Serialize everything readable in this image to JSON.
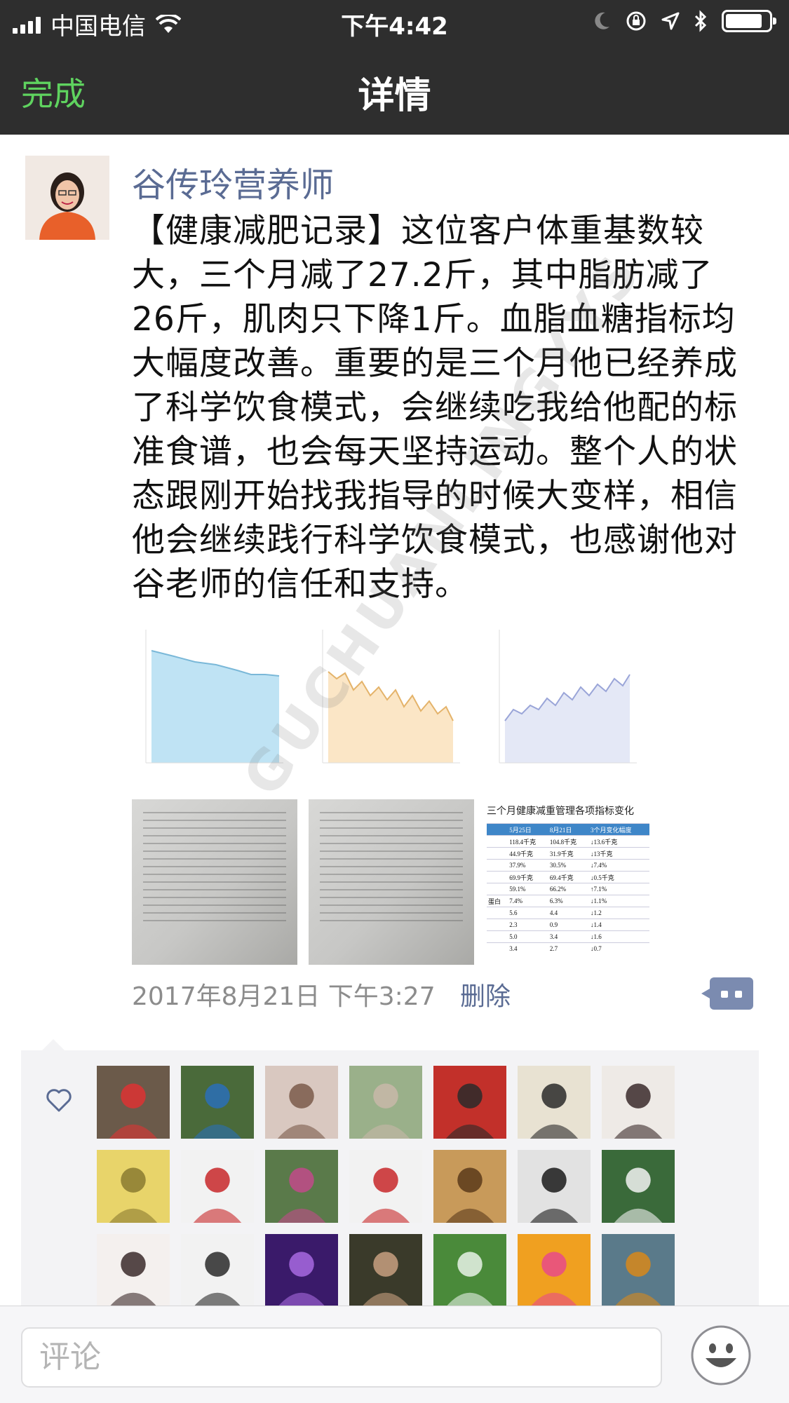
{
  "status_bar": {
    "carrier": "中国电信",
    "time": "下午4:42"
  },
  "nav": {
    "done_label": "完成",
    "title": "详情"
  },
  "post": {
    "author": "谷传玲营养师",
    "text": "【健康减肥记录】这位客户体重基数较大，三个月减了27.2斤，其中脂肪减了26斤，肌肉只下降1斤。血脂血糖指标均大幅度改善。重要的是三个月他已经养成了科学饮食模式，会继续吃我给他配的标准食谱，也会每天坚持运动。整个人的状态跟刚开始找我指导的时候大变样，相信他会继续践行科学饮食模式，也感谢他对谷老师的信任和支持。",
    "timestamp": "2017年8月21日 下午3:27",
    "delete_label": "删除",
    "watermark": "GUCHUANLINGYYS",
    "table_image": {
      "title": "三个月健康减重管理各项指标变化",
      "header": [
        "5月25日",
        "8月21日",
        "3个月变化幅度"
      ],
      "rows": [
        [
          "",
          "118.4千克",
          "104.8千克",
          "↓13.6千克"
        ],
        [
          "",
          "44.9千克",
          "31.9千克",
          "↓13千克"
        ],
        [
          "",
          "37.9%",
          "30.5%",
          "↓7.4%"
        ],
        [
          "",
          "69.9千克",
          "69.4千克",
          "↓0.5千克"
        ],
        [
          "",
          "59.1%",
          "66.2%",
          "↑7.1%"
        ],
        [
          "蛋白",
          "7.4%",
          "6.3%",
          "↓1.1%"
        ],
        [
          "",
          "5.6",
          "4.4",
          "↓1.2"
        ],
        [
          "",
          "2.3",
          "0.9",
          "↓1.4"
        ],
        [
          "",
          "5.0",
          "3.4",
          "↓1.6"
        ],
        [
          "",
          "3.4",
          "2.7",
          "↓0.7"
        ]
      ]
    }
  },
  "comment_bar": {
    "placeholder": "评论"
  },
  "colors": {
    "nav_bg": "#2e2e2e",
    "done_green": "#5fd35f",
    "link_blue": "#5a6b93",
    "likes_bg": "#f3f3f5"
  },
  "likes": {
    "avatars": [
      "avatar-red-balloon",
      "avatar-man-outdoor",
      "avatar-woman-portrait",
      "avatar-hand-flower-road",
      "avatar-cartoon-red",
      "avatar-cartoon-man",
      "avatar-woman-white",
      "avatar-corn",
      "avatar-cat-santa-hat",
      "avatar-woman-garden",
      "avatar-cartoon-girl-santa",
      "avatar-swans-sunset",
      "avatar-woman-glasses",
      "avatar-woman-green",
      "avatar-woman-smile",
      "avatar-girl-glasses",
      "avatar-purple-moon",
      "avatar-child-soldier-hat",
      "avatar-green-grass",
      "avatar-lotus-hands",
      "avatar-mountain-landscape"
    ]
  }
}
